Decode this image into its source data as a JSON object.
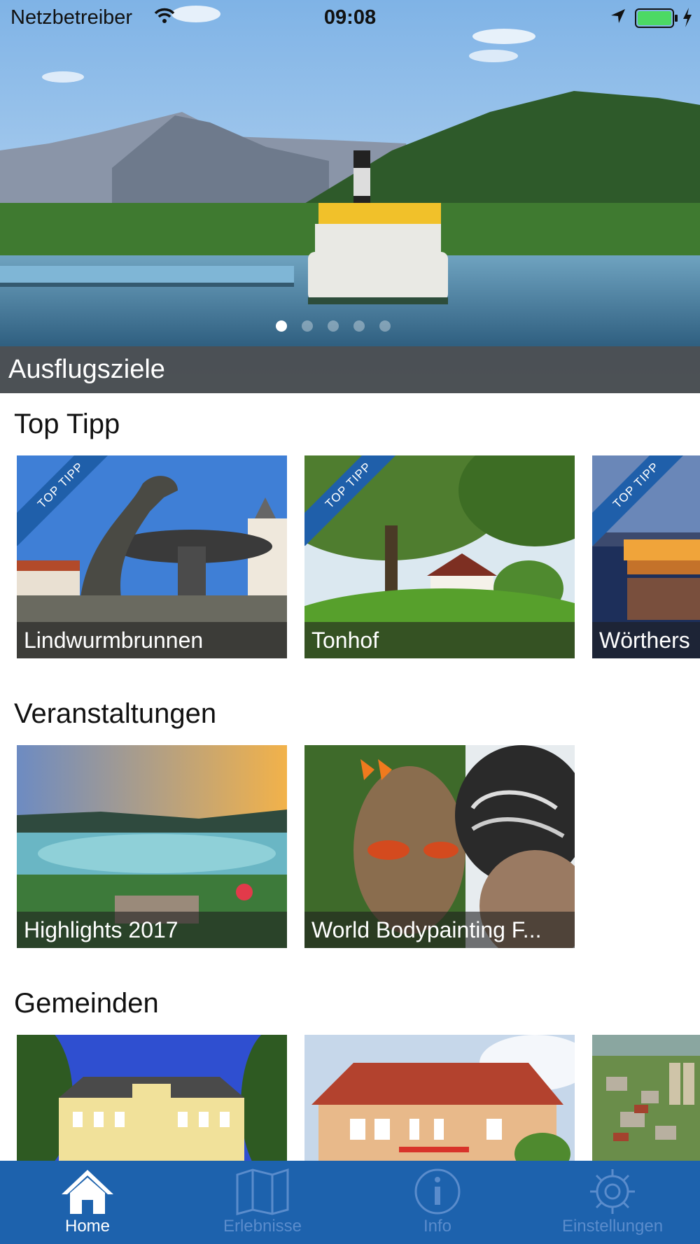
{
  "status_bar": {
    "carrier": "Netzbetreiber",
    "time": "09:08"
  },
  "hero": {
    "title": "Ausflugsziele",
    "page_count": 5,
    "active_page": 1
  },
  "sections": {
    "top_tipp": {
      "title": "Top Tipp",
      "ribbon_label": "TOP TIPP",
      "items": [
        {
          "label": "Lindwurmbrunnen"
        },
        {
          "label": "Tonhof"
        },
        {
          "label": "Wörthers"
        }
      ]
    },
    "veranstaltungen": {
      "title": "Veranstaltungen",
      "items": [
        {
          "label": "Highlights 2017"
        },
        {
          "label": "World Bodypainting F..."
        }
      ]
    },
    "gemeinden": {
      "title": "Gemeinden",
      "items": [
        {},
        {},
        {}
      ]
    }
  },
  "tab_bar": {
    "tabs": [
      {
        "label": "Home",
        "icon": "home-icon",
        "active": true
      },
      {
        "label": "Erlebnisse",
        "icon": "map-icon",
        "active": false
      },
      {
        "label": "Info",
        "icon": "info-icon",
        "active": false
      },
      {
        "label": "Einstellungen",
        "icon": "gear-icon",
        "active": false
      }
    ]
  },
  "colors": {
    "tab_bar": "#1d62ad",
    "ribbon": "#1f5faa",
    "battery": "#4cd964"
  }
}
